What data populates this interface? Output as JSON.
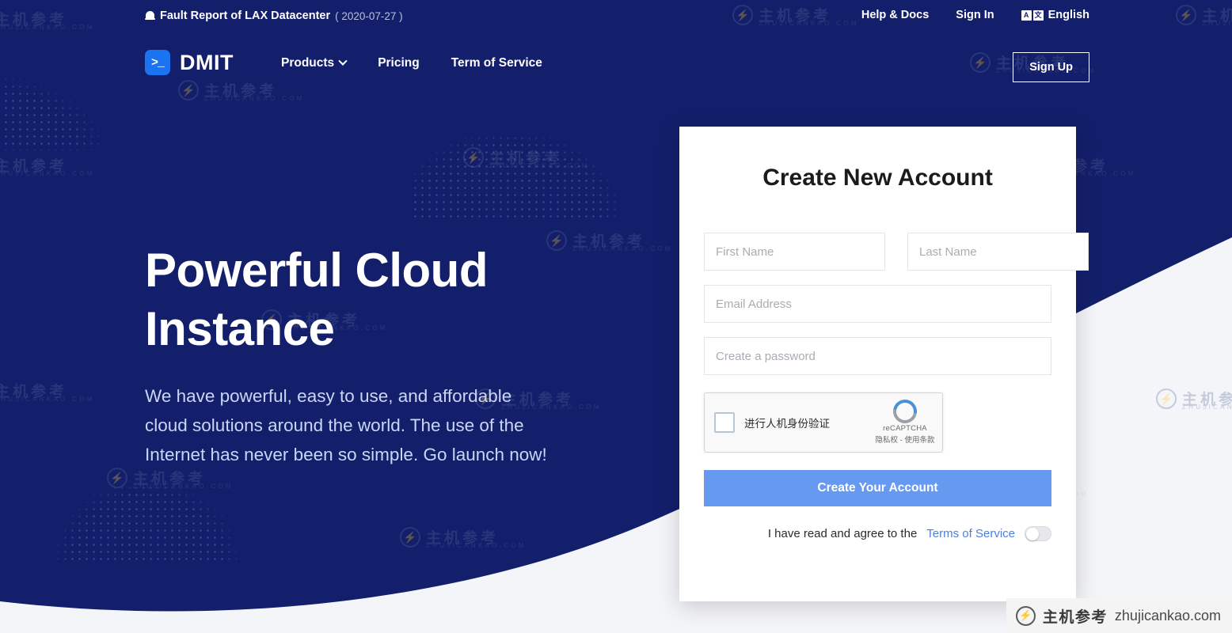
{
  "announcement": {
    "icon": "bell-icon",
    "text": "Fault Report of LAX Datacenter",
    "date": "( 2020-07-27 )"
  },
  "topnav": {
    "help": "Help & Docs",
    "signin": "Sign In",
    "language": "English",
    "lang_icon_a": "A",
    "lang_icon_b": "文"
  },
  "brand": {
    "logo_glyph": ">_",
    "name": "DMIT"
  },
  "mainnav": {
    "products": "Products",
    "pricing": "Pricing",
    "terms": "Term of Service",
    "signup": "Sign Up"
  },
  "hero": {
    "title_line1": "Powerful Cloud",
    "title_line2": "Instance",
    "subtitle": "We have powerful, easy to use, and affordable cloud solutions around the world. The use of the Internet has never been so simple. Go launch now!"
  },
  "signup_form": {
    "title": "Create New Account",
    "first_name_placeholder": "First Name",
    "first_name_value": "",
    "last_name_placeholder": "Last Name",
    "last_name_value": "",
    "email_placeholder": "Email Address",
    "email_value": "",
    "password_placeholder": "Create a password",
    "password_value": "",
    "submit_label": "Create Your Account",
    "terms_text": "I have read and agree to the",
    "terms_link": "Terms of Service",
    "terms_toggle_state": "off"
  },
  "recaptcha": {
    "checkbox_label": "进行人机身份验证",
    "brand_name": "reCAPTCHA",
    "terms": "隐私权 - 使用条款"
  },
  "watermark": {
    "cn": "主机参考",
    "en": "ZHUJICANKAO.COM",
    "mark": "⚡"
  },
  "badge": {
    "cn": "主机参考",
    "url": "zhujicankao.com",
    "mark": "⚡"
  },
  "colors": {
    "hero_navy": "#141f6b",
    "accent_button": "#6699f0",
    "logo_blue": "#1a73f0",
    "link_blue": "#4a7fe0",
    "page_bg": "#f4f5f9"
  }
}
